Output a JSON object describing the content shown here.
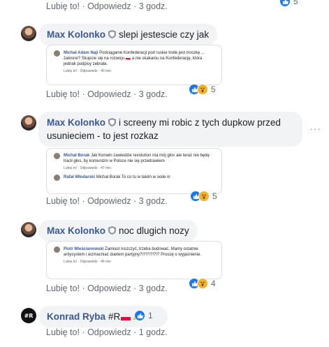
{
  "actions_common": {
    "like": "Lubię to!",
    "sep": " · ",
    "reply": "Odpowiedz",
    "sep2": " · "
  },
  "top_row": {
    "time": "3 godz.",
    "reactions": "5"
  },
  "comments": [
    {
      "author": "Max Kolonko",
      "text": "slepi jestescie czy jak",
      "screenshot": {
        "name": "Michał Adam Naji",
        "text": "Podciąganie Konfederacji pod ruskie trolle jest troszkę ... żałosne? Skupcie się na rozwoju 🇵🇱 a nie skakaniu na Konfederację, która jednak podpisy zebrała.",
        "actions": "Lubię to! · Odpowiedz · 40 min"
      },
      "time": "3 godz.",
      "reactions": "5"
    },
    {
      "author": "Max Kolonko",
      "text_line1": "i screeny mi robic z tych dupkow przed",
      "text_line2": "usunieciem - to jest rozkaz",
      "screenshot": {
        "name": "Michał Borak",
        "text": "Jak Konwin zawiedzie revolution ma mój głos ale teraz nie będę tracił głos, by komunizm w Polsce nie się przedrawiem",
        "actions": "Lubię to! · Odpowiedz · 47 min",
        "name2": "Rafał Włodarski",
        "text2": "Michał Borak To co tu w takim w ooile ni"
      },
      "time": "3 godz.",
      "reactions": "5"
    },
    {
      "author": "Max Kolonko",
      "text": "noc dlugich nozy",
      "screenshot": {
        "name": "Piotr Mleścianowski",
        "text": "Zamiast niszczyć, trzeba budować. Mamy ostatnie antysystem i wzmacniać duetem partyjny?!?!?!?!?!? Proszę o wyjaśnienie.",
        "actions": "Lubię to! · Odpowiedz · 46 min"
      },
      "time": "3 godz.",
      "reactions": "4"
    },
    {
      "author": "Konrad Ryba",
      "avatar_text": "#R",
      "text": "#R",
      "time": "1 godz.",
      "reactions": "1"
    }
  ],
  "more_options": "···",
  "colors": {
    "link": "#385898",
    "like": "#1877f2",
    "wow": "#f7b125",
    "bubble": "#f2f3f5",
    "muted": "#606770"
  }
}
